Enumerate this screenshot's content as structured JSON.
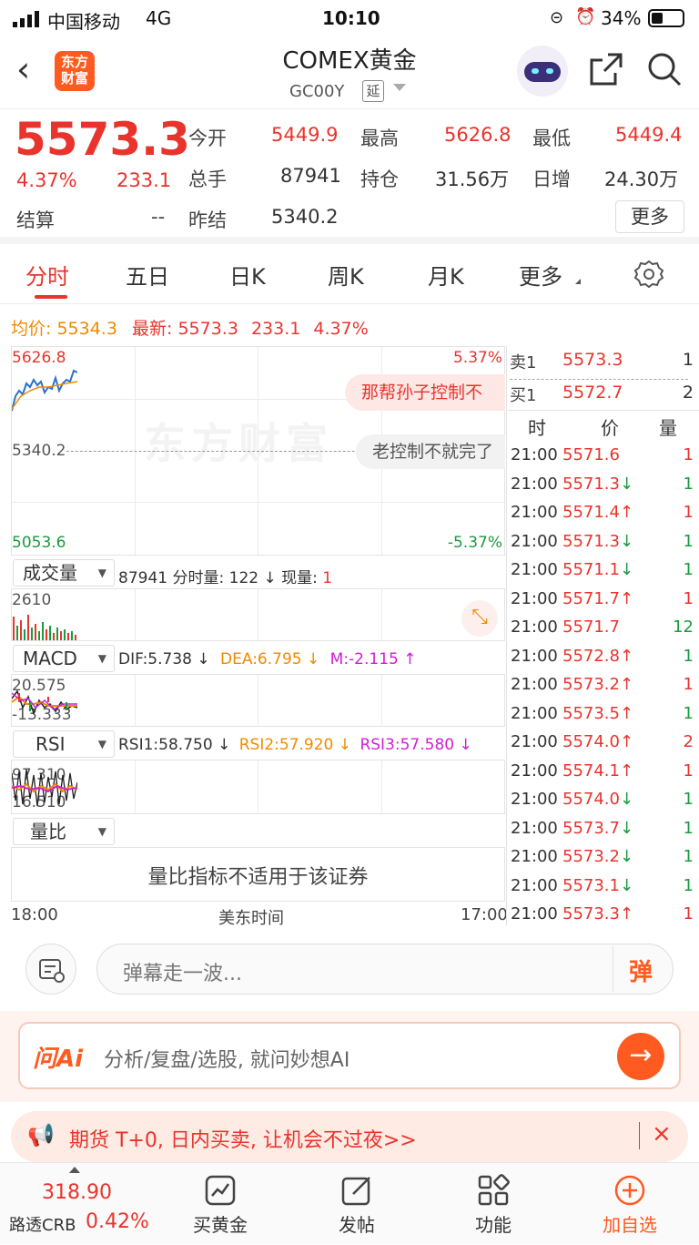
{
  "status": {
    "carrier": "中国移动",
    "network": "4G",
    "time": "10:10",
    "battery": "34%"
  },
  "header": {
    "title": "COMEX黄金",
    "code": "GC00Y",
    "delay_badge": "延",
    "logo_line1": "东方",
    "logo_line2": "财富"
  },
  "quote": {
    "price": "5573.3",
    "pct": "4.37%",
    "chg": "233.1",
    "settle_label": "结算",
    "settle_val": "--",
    "prev_label": "昨结",
    "prev_val": "5340.2",
    "open_label": "今开",
    "open_val": "5449.9",
    "high_label": "最高",
    "high_val": "5626.8",
    "low_label": "最低",
    "low_val": "5449.4",
    "vol_label": "总手",
    "vol_val": "87941",
    "oi_label": "持仓",
    "oi_val": "31.56万",
    "dayinc_label": "日增",
    "dayinc_val": "24.30万",
    "more_label": "更多"
  },
  "tabs": [
    "分时",
    "五日",
    "日K",
    "周K",
    "月K",
    "更多"
  ],
  "chart": {
    "avg_label": "均价:",
    "avg_val": "5534.3",
    "latest_label": "最新:",
    "latest_val": "5573.3",
    "latest_chg": "233.1",
    "latest_pct": "4.37%",
    "y_high": "5626.8",
    "y_mid": "5340.2",
    "y_low": "5053.6",
    "pct_high": "5.37%",
    "pct_low": "-5.37%",
    "danmu1": "那帮孙子控制不",
    "danmu2": "老控制不就完了",
    "watermark": "东方财富",
    "vol_select": "成交量",
    "vol_total": "87941",
    "vol_min_label": "分时量:",
    "vol_min_val": "122",
    "vol_now_label": "现量:",
    "vol_now_val": "1",
    "vol_axis": "2610",
    "macd_select": "MACD",
    "dif": "DIF:5.738",
    "dea": "DEA:6.795",
    "m": "M:-2.115",
    "macd_top": "20.575",
    "macd_bottom": "-13.333",
    "rsi_select": "RSI",
    "rsi1": "RSI1:58.750",
    "rsi2": "RSI2:57.920",
    "rsi3": "RSI3:57.580",
    "rsi_top": "97.310",
    "rsi_bottom": "16.510",
    "qb_select": "量比",
    "qb_note": "量比指标不适用于该证券",
    "time_start": "18:00",
    "time_mid": "美东时间",
    "time_end": "17:00"
  },
  "orderbook": {
    "sell1_label": "卖1",
    "sell1_price": "5573.3",
    "sell1_qty": "1",
    "buy1_label": "买1",
    "buy1_price": "5572.7",
    "buy1_qty": "2",
    "hdr_time": "时",
    "hdr_price": "价",
    "hdr_qty": "量",
    "ticks": [
      {
        "t": "21:00",
        "p": "5571.6",
        "a": "",
        "q": "1",
        "c": "red"
      },
      {
        "t": "21:00",
        "p": "5571.3",
        "a": "↓",
        "q": "1",
        "c": "grn"
      },
      {
        "t": "21:00",
        "p": "5571.4",
        "a": "↑",
        "q": "1",
        "c": "red"
      },
      {
        "t": "21:00",
        "p": "5571.3",
        "a": "↓",
        "q": "1",
        "c": "grn"
      },
      {
        "t": "21:00",
        "p": "5571.1",
        "a": "↓",
        "q": "1",
        "c": "grn"
      },
      {
        "t": "21:00",
        "p": "5571.7",
        "a": "↑",
        "q": "1",
        "c": "red"
      },
      {
        "t": "21:00",
        "p": "5571.7",
        "a": "",
        "q": "12",
        "c": "grn"
      },
      {
        "t": "21:00",
        "p": "5572.8",
        "a": "↑",
        "q": "1",
        "c": "grn"
      },
      {
        "t": "21:00",
        "p": "5573.2",
        "a": "↑",
        "q": "1",
        "c": "red"
      },
      {
        "t": "21:00",
        "p": "5573.5",
        "a": "↑",
        "q": "1",
        "c": "grn"
      },
      {
        "t": "21:00",
        "p": "5574.0",
        "a": "↑",
        "q": "2",
        "c": "red"
      },
      {
        "t": "21:00",
        "p": "5574.1",
        "a": "↑",
        "q": "1",
        "c": "red"
      },
      {
        "t": "21:00",
        "p": "5574.0",
        "a": "↓",
        "q": "1",
        "c": "grn"
      },
      {
        "t": "21:00",
        "p": "5573.7",
        "a": "↓",
        "q": "1",
        "c": "grn"
      },
      {
        "t": "21:00",
        "p": "5573.2",
        "a": "↓",
        "q": "1",
        "c": "grn"
      },
      {
        "t": "21:00",
        "p": "5573.1",
        "a": "↓",
        "q": "1",
        "c": "grn"
      },
      {
        "t": "21:00",
        "p": "5573.3",
        "a": "↑",
        "q": "1",
        "c": "red"
      }
    ]
  },
  "danmu": {
    "placeholder": "弹幕走一波...",
    "button": "弹"
  },
  "askai": {
    "brand": "问Ai",
    "placeholder": "分析/复盘/选股, 就问妙想AI"
  },
  "promo": {
    "text": "期货 T+0, 日内买卖, 让机会不过夜>>"
  },
  "bottom": {
    "index_val": "318.90",
    "index_name": "路透CRB",
    "index_pct": "0.42%",
    "items": [
      "买黄金",
      "发帖",
      "功能",
      "加自选"
    ]
  },
  "colors": {
    "up": "#e8342c",
    "down": "#1a9b3e",
    "accent": "#ff5a1f",
    "avg": "#f08a00",
    "line": "#2a73c9"
  }
}
